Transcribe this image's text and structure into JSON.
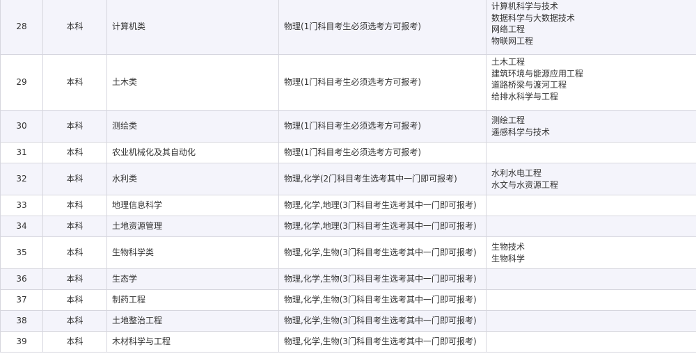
{
  "table": {
    "rows": [
      {
        "no": "28",
        "level": "本科",
        "category": "计算机类",
        "subjects": "物理(1门科目考生必须选考方可报考)",
        "majors": [
          "计算机科学与技术",
          "数据科学与大数据技术",
          "网络工程",
          "物联网工程"
        ]
      },
      {
        "no": "29",
        "level": "本科",
        "category": "土木类",
        "subjects": "物理(1门科目考生必须选考方可报考)",
        "majors": [
          "土木工程",
          "建筑环境与能源应用工程",
          "道路桥梁与渡河工程",
          "给排水科学与工程"
        ]
      },
      {
        "no": "30",
        "level": "本科",
        "category": "测绘类",
        "subjects": "物理(1门科目考生必须选考方可报考)",
        "majors": [
          "测绘工程",
          "遥感科学与技术"
        ]
      },
      {
        "no": "31",
        "level": "本科",
        "category": "农业机械化及其自动化",
        "subjects": "物理(1门科目考生必须选考方可报考)",
        "majors": []
      },
      {
        "no": "32",
        "level": "本科",
        "category": "水利类",
        "subjects": "物理,化学(2门科目考生选考其中一门即可报考)",
        "majors": [
          "水利水电工程",
          "水文与水资源工程"
        ]
      },
      {
        "no": "33",
        "level": "本科",
        "category": "地理信息科学",
        "subjects": "物理,化学,地理(3门科目考生选考其中一门即可报考)",
        "majors": []
      },
      {
        "no": "34",
        "level": "本科",
        "category": "土地资源管理",
        "subjects": "物理,化学,地理(3门科目考生选考其中一门即可报考)",
        "majors": []
      },
      {
        "no": "35",
        "level": "本科",
        "category": "生物科学类",
        "subjects": "物理,化学,生物(3门科目考生选考其中一门即可报考)",
        "majors": [
          "生物技术",
          "生物科学"
        ]
      },
      {
        "no": "36",
        "level": "本科",
        "category": "生态学",
        "subjects": "物理,化学,生物(3门科目考生选考其中一门即可报考)",
        "majors": []
      },
      {
        "no": "37",
        "level": "本科",
        "category": "制药工程",
        "subjects": "物理,化学,生物(3门科目考生选考其中一门即可报考)",
        "majors": []
      },
      {
        "no": "38",
        "level": "本科",
        "category": "土地整治工程",
        "subjects": "物理,化学,生物(3门科目考生选考其中一门即可报考)",
        "majors": []
      },
      {
        "no": "39",
        "level": "本科",
        "category": "木材科学与工程",
        "subjects": "物理,化学,生物(3门科目考生选考其中一门即可报考)",
        "majors": []
      }
    ]
  }
}
